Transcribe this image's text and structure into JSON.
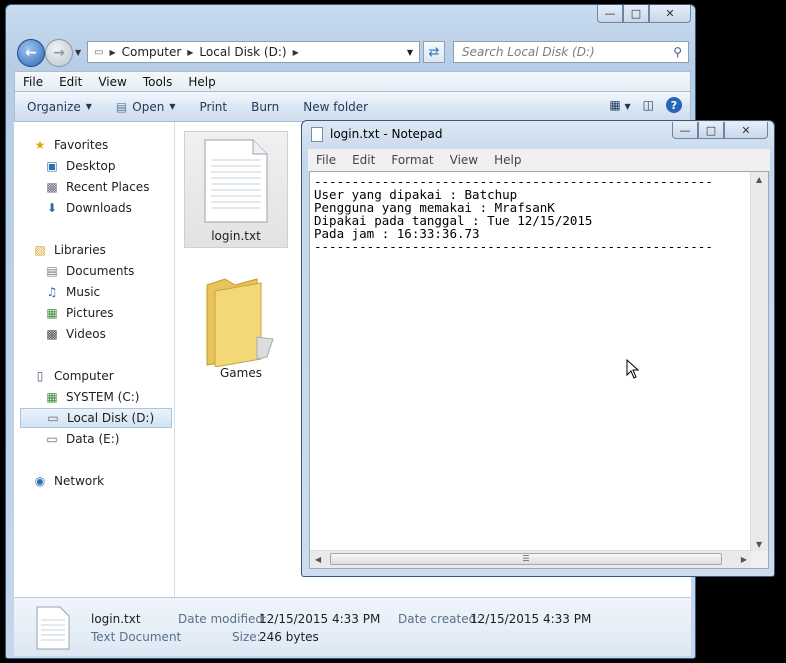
{
  "explorer": {
    "address": [
      "Computer",
      "Local Disk (D:)"
    ],
    "search_placeholder": "Search Local Disk (D:)",
    "menu": [
      "File",
      "Edit",
      "View",
      "Tools",
      "Help"
    ],
    "toolbar": {
      "organize": "Organize",
      "open": "Open",
      "print": "Print",
      "burn": "Burn",
      "new_folder": "New folder"
    },
    "nav": {
      "favorites": "Favorites",
      "desktop": "Desktop",
      "recent": "Recent Places",
      "downloads": "Downloads",
      "libraries": "Libraries",
      "documents": "Documents",
      "music": "Music",
      "pictures": "Pictures",
      "videos": "Videos",
      "computer": "Computer",
      "system_c": "SYSTEM (C:)",
      "local_d": "Local Disk (D:)",
      "data_e": "Data (E:)",
      "network": "Network"
    },
    "files": {
      "login": "login.txt",
      "games": "Games"
    },
    "details": {
      "name": "login.txt",
      "type": "Text Document",
      "modified_label": "Date modified:",
      "modified": "12/15/2015 4:33 PM",
      "created_label": "Date created:",
      "created": "12/15/2015 4:33 PM",
      "size_label": "Size:",
      "size": "246 bytes"
    }
  },
  "notepad": {
    "title": "login.txt - Notepad",
    "menu": [
      "File",
      "Edit",
      "Format",
      "View",
      "Help"
    ],
    "content": "-----------------------------------------------------\nUser yang dipakai : Batchup\nPengguna yang memakai : MrafsanK\nDipakai pada tanggal : Tue 12/15/2015\nPada jam : 16:33:36.73\n-----------------------------------------------------"
  },
  "colors": {
    "accent": "#2766b4",
    "selection": "#d4e3f3"
  }
}
